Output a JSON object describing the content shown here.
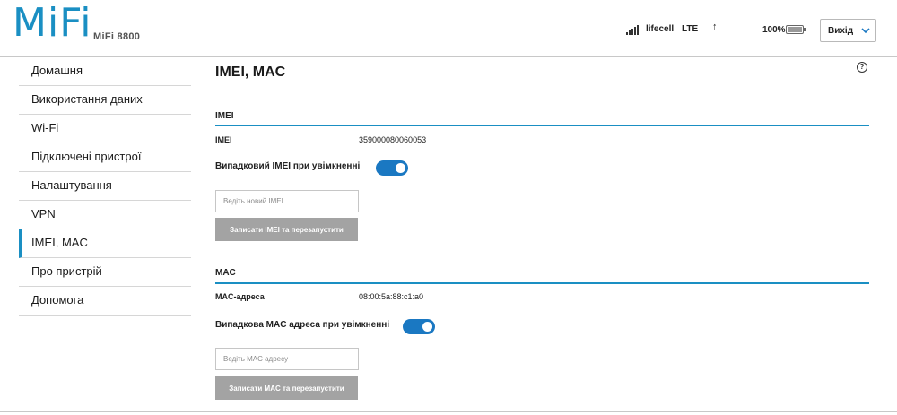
{
  "header": {
    "brand": "MiFi",
    "model": "MiFi 8800",
    "signal_icon": "signal-bars-icon",
    "carrier": "lifecell",
    "network": "LTE",
    "upload_indicator": "↑",
    "battery_percent": "100%",
    "battery_level": 1.0,
    "logout_label": "Вихід"
  },
  "sidebar": {
    "items": [
      {
        "label": "Домашня"
      },
      {
        "label": "Використання даних"
      },
      {
        "label": "Wi-Fi"
      },
      {
        "label": "Підключені пристрої"
      },
      {
        "label": "Налаштування"
      },
      {
        "label": "VPN"
      },
      {
        "label": "IMEI, MAC"
      },
      {
        "label": "Про пристрій"
      },
      {
        "label": "Допомога"
      }
    ],
    "active": "IMEI, MAC"
  },
  "main": {
    "title": "IMEI, MAC",
    "help_icon": "?",
    "imei": {
      "section_title": "IMEI",
      "key": "IMEI",
      "value": "359000080060053",
      "toggle_label": "Випадковий IMEI при увімкненні",
      "toggle_on": true,
      "input_placeholder": "Ведіть новий IMEI",
      "input_value": "",
      "button_label": "Записати IMEI та перезапустити"
    },
    "mac": {
      "section_title": "MAC",
      "key": "MAC-адреса",
      "value": "08:00:5a:88:c1:a0",
      "toggle_label": "Випадкова MAC адреса при увімкненні",
      "toggle_on": true,
      "input_placeholder": "Ведіть MAC адресу",
      "input_value": "",
      "button_label": "Записати MAC та перезапустити"
    }
  },
  "colors": {
    "accent": "#1a8fc3",
    "toggle": "#1a78c2",
    "button_disabled": "#a3a3a3"
  }
}
